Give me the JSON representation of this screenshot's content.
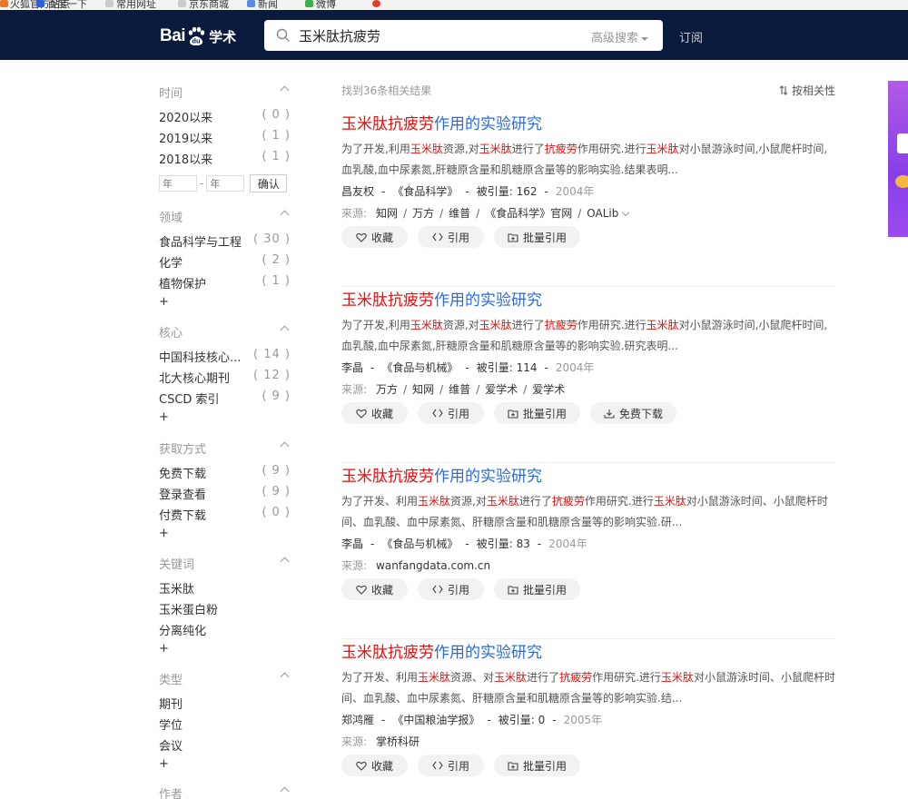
{
  "bookmarks": [
    {
      "label": "火狐官方站点"
    },
    {
      "label": "百度一下"
    },
    {
      "label": "常用网址"
    },
    {
      "label": "京东商城"
    },
    {
      "label": "新闻"
    },
    {
      "label": "微博"
    }
  ],
  "header": {
    "logo_text_bai": "Bai",
    "logo_text_du": "du",
    "logo_text_xs": "学术",
    "search_value": "玉米肽抗疲劳",
    "advanced_label": "高级搜索",
    "subscribe_label": "订阅"
  },
  "sidebar": {
    "time": {
      "title": "时间",
      "items": [
        {
          "label": "2020以来",
          "count": "( 0 )"
        },
        {
          "label": "2019以来",
          "count": "( 1 )"
        },
        {
          "label": "2018以来",
          "count": "( 1 )"
        }
      ],
      "year_from_placeholder": "年",
      "year_to_placeholder": "年",
      "dash": "-",
      "confirm_label": "确认"
    },
    "field": {
      "title": "领域",
      "items": [
        {
          "label": "食品科学与工程",
          "count": "( 30 )"
        },
        {
          "label": "化学",
          "count": "( 2 )"
        },
        {
          "label": "植物保护",
          "count": "( 1 )"
        }
      ],
      "more": "+"
    },
    "core": {
      "title": "核心",
      "items": [
        {
          "label": "中国科技核心...",
          "count": "( 14 )"
        },
        {
          "label": "北大核心期刊",
          "count": "( 12 )"
        },
        {
          "label": "CSCD 索引",
          "count": "( 9 )"
        }
      ],
      "more": "+"
    },
    "access": {
      "title": "获取方式",
      "items": [
        {
          "label": "免费下载",
          "count": "( 9 )"
        },
        {
          "label": "登录查看",
          "count": "( 9 )"
        },
        {
          "label": "付费下载",
          "count": "( 0 )"
        }
      ],
      "more": "+"
    },
    "keywords": {
      "title": "关键词",
      "items": [
        {
          "label": "玉米肽"
        },
        {
          "label": "玉米蛋白粉"
        },
        {
          "label": "分离纯化"
        }
      ],
      "more": "+"
    },
    "type": {
      "title": "类型",
      "items": [
        {
          "label": "期刊"
        },
        {
          "label": "学位"
        },
        {
          "label": "会议"
        }
      ],
      "more": "+"
    },
    "author": {
      "title": "作者"
    }
  },
  "main": {
    "result_count": "找到36条相关结果",
    "sort_label": "按相关性",
    "results": [
      {
        "title_hl": "玉米肽抗疲劳",
        "title_rest": "作用的实验研究",
        "abstract": [
          {
            "t": "为了开发,利用",
            "h": false
          },
          {
            "t": "玉米肽",
            "h": true
          },
          {
            "t": "资源,对",
            "h": false
          },
          {
            "t": "玉米肽",
            "h": true
          },
          {
            "t": "进行了",
            "h": false
          },
          {
            "t": "抗疲劳",
            "h": true
          },
          {
            "t": "作用研究.进行",
            "h": false
          },
          {
            "t": "玉米肽",
            "h": true
          },
          {
            "t": "对小鼠游泳时间,小鼠爬杆时间,血乳酸,血中尿素氮,肝糖原含量和肌糖原含量等的影响实验.结果表明...",
            "h": false
          }
        ],
        "author": "昌友权",
        "journal": "《食品科学》",
        "cite_label": "被引量:",
        "cite_count": "162",
        "year": "2004年",
        "source_label": "来源:",
        "sources": [
          "知网",
          "万方",
          "维普",
          "《食品科学》官网",
          "OALib"
        ],
        "has_more_sources": true,
        "actions": [
          "收藏",
          "引用",
          "批量引用"
        ]
      },
      {
        "title_hl": "玉米肽抗疲劳",
        "title_rest": "作用的实验研究",
        "abstract": [
          {
            "t": "为了开发,利用",
            "h": false
          },
          {
            "t": "玉米肽",
            "h": true
          },
          {
            "t": "资源,对",
            "h": false
          },
          {
            "t": "玉米肽",
            "h": true
          },
          {
            "t": "进行了",
            "h": false
          },
          {
            "t": "抗疲劳",
            "h": true
          },
          {
            "t": "作用研究.进行",
            "h": false
          },
          {
            "t": "玉米肽",
            "h": true
          },
          {
            "t": "对小鼠游泳时间,小鼠爬杆时间,血乳酸,血中尿素氮,肝糖原含量和肌糖原含量等的影响实验.研究表明...",
            "h": false
          }
        ],
        "author": "李晶",
        "journal": "《食品与机械》",
        "cite_label": "被引量:",
        "cite_count": "114",
        "year": "2004年",
        "source_label": "来源:",
        "sources": [
          "万方",
          "知网",
          "维普",
          "爱学术",
          "爱学术"
        ],
        "has_more_sources": false,
        "actions": [
          "收藏",
          "引用",
          "批量引用",
          "免费下载"
        ]
      },
      {
        "title_hl": "玉米肽抗疲劳",
        "title_rest": "作用的实验研究",
        "abstract": [
          {
            "t": "为了开发、利用",
            "h": false
          },
          {
            "t": "玉米肽",
            "h": true
          },
          {
            "t": "资源,对",
            "h": false
          },
          {
            "t": "玉米肽",
            "h": true
          },
          {
            "t": "进行了",
            "h": false
          },
          {
            "t": "抗疲劳",
            "h": true
          },
          {
            "t": "作用研究.进行",
            "h": false
          },
          {
            "t": "玉米肽",
            "h": true
          },
          {
            "t": "对小鼠游泳时间、小鼠爬杆时间、血乳酸、血中尿素氮、肝糖原含量和肌糖原含量等的影响实验.研...",
            "h": false
          }
        ],
        "author": "李晶",
        "journal": "《食品与机械》",
        "cite_label": "被引量:",
        "cite_count": "83",
        "year": "2004年",
        "source_label": "来源:",
        "sources": [
          "wanfangdata.com.cn"
        ],
        "has_more_sources": false,
        "actions": [
          "收藏",
          "引用",
          "批量引用"
        ]
      },
      {
        "title_hl": "玉米肽抗疲劳",
        "title_rest": "作用的实验研究",
        "abstract": [
          {
            "t": "为了开发、利用",
            "h": false
          },
          {
            "t": "玉米肽",
            "h": true
          },
          {
            "t": "资源、对",
            "h": false
          },
          {
            "t": "玉米肽",
            "h": true
          },
          {
            "t": "进行了",
            "h": false
          },
          {
            "t": "抗疲劳",
            "h": true
          },
          {
            "t": "作用研究.进行",
            "h": false
          },
          {
            "t": "玉米肽",
            "h": true
          },
          {
            "t": "对小鼠游泳时间、小鼠爬杆时间、血乳酸、血中尿素氮、肝糖原含量和肌糖原含量等的影响实验.结...",
            "h": false
          }
        ],
        "author": "郑鸿雁",
        "journal": "《中国粮油学报》",
        "cite_label": "被引量:",
        "cite_count": "0",
        "year": "2005年",
        "source_label": "来源:",
        "sources": [
          "掌桥科研"
        ],
        "has_more_sources": false,
        "actions": [
          "收藏",
          "引用",
          "批量引用"
        ]
      }
    ]
  },
  "colors": {
    "header_bg": "#0a1a3c",
    "link_blue": "#2a6bd6",
    "highlight_red": "#dd1111",
    "button_bg": "#f2f2f2"
  }
}
